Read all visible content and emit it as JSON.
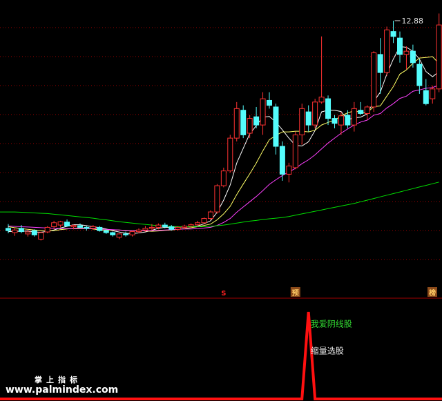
{
  "colors": {
    "background": "#000000",
    "grid": "#a00000",
    "up": "#ff3232",
    "down": "#54fcfc",
    "ma5": "#ffffff",
    "ma10": "#ffff66",
    "ma20": "#ff40ff",
    "ma60": "#00e000",
    "indicator": "#ff1010",
    "signal_box": "#8b4a1a"
  },
  "chart_data": [
    {
      "type": "candlestick",
      "title": "",
      "xlabel": "",
      "ylabel": "",
      "ylim": [
        5.2,
        13.3
      ],
      "grid": true,
      "high_label": "12.88",
      "high_value": 12.88,
      "series": [
        {
          "name": "",
          "role": "candles",
          "ohlc": [
            [
              6.55,
              6.68,
              6.4,
              6.48
            ],
            [
              6.42,
              6.58,
              6.32,
              6.5
            ],
            [
              6.55,
              6.65,
              6.4,
              6.45
            ],
            [
              6.38,
              6.52,
              6.3,
              6.44
            ],
            [
              6.48,
              6.52,
              6.3,
              6.35
            ],
            [
              6.22,
              6.45,
              6.18,
              6.42
            ],
            [
              6.44,
              6.62,
              6.4,
              6.58
            ],
            [
              6.6,
              6.78,
              6.52,
              6.72
            ],
            [
              6.65,
              6.78,
              6.58,
              6.75
            ],
            [
              6.74,
              6.82,
              6.6,
              6.62
            ],
            [
              6.6,
              6.66,
              6.52,
              6.64
            ],
            [
              6.63,
              6.7,
              6.55,
              6.58
            ],
            [
              6.58,
              6.62,
              6.48,
              6.55
            ],
            [
              6.55,
              6.65,
              6.5,
              6.6
            ],
            [
              6.58,
              6.62,
              6.45,
              6.48
            ],
            [
              6.48,
              6.52,
              6.38,
              6.42
            ],
            [
              6.42,
              6.45,
              6.3,
              6.35
            ],
            [
              6.28,
              6.4,
              6.22,
              6.38
            ],
            [
              6.38,
              6.45,
              6.3,
              6.35
            ],
            [
              6.35,
              6.48,
              6.3,
              6.45
            ],
            [
              6.45,
              6.55,
              6.4,
              6.5
            ],
            [
              6.5,
              6.62,
              6.45,
              6.55
            ],
            [
              6.55,
              6.68,
              6.48,
              6.58
            ],
            [
              6.58,
              6.7,
              6.52,
              6.65
            ],
            [
              6.65,
              6.72,
              6.55,
              6.6
            ],
            [
              6.6,
              6.65,
              6.48,
              6.52
            ],
            [
              6.52,
              6.62,
              6.48,
              6.58
            ],
            [
              6.58,
              6.66,
              6.52,
              6.62
            ],
            [
              6.62,
              6.7,
              6.56,
              6.66
            ],
            [
              6.66,
              6.78,
              6.6,
              6.72
            ],
            [
              6.72,
              6.88,
              6.68,
              6.85
            ],
            [
              6.85,
              7.1,
              6.8,
              7.05
            ],
            [
              7.05,
              7.9,
              7.0,
              7.85
            ],
            [
              7.85,
              8.4,
              7.8,
              8.3
            ],
            [
              8.3,
              9.4,
              8.25,
              9.3
            ],
            [
              9.3,
              10.4,
              9.2,
              10.2
            ],
            [
              10.15,
              10.3,
              9.3,
              9.4
            ],
            [
              9.45,
              10.0,
              9.3,
              9.9
            ],
            [
              9.95,
              10.25,
              9.6,
              9.7
            ],
            [
              9.7,
              10.7,
              9.4,
              10.5
            ],
            [
              10.45,
              10.7,
              10.2,
              10.3
            ],
            [
              10.25,
              10.35,
              8.8,
              9.05
            ],
            [
              9.05,
              9.2,
              8.0,
              8.2
            ],
            [
              8.2,
              8.55,
              7.95,
              8.45
            ],
            [
              8.4,
              9.5,
              8.35,
              9.4
            ],
            [
              9.4,
              10.35,
              9.1,
              10.2
            ],
            [
              10.1,
              10.3,
              9.5,
              9.7
            ],
            [
              9.7,
              10.5,
              9.6,
              10.4
            ],
            [
              10.4,
              12.4,
              10.35,
              10.55
            ],
            [
              10.5,
              10.6,
              9.7,
              9.9
            ],
            [
              9.9,
              10.0,
              9.6,
              9.75
            ],
            [
              9.7,
              10.1,
              9.4,
              9.98
            ],
            [
              10.0,
              10.15,
              9.6,
              9.7
            ],
            [
              9.7,
              10.4,
              9.5,
              10.2
            ],
            [
              10.15,
              10.4,
              10.0,
              10.05
            ],
            [
              10.05,
              10.3,
              9.85,
              10.25
            ],
            [
              10.25,
              11.95,
              10.1,
              11.9
            ],
            [
              11.85,
              12.35,
              10.65,
              11.3
            ],
            [
              11.3,
              12.7,
              11.2,
              12.6
            ],
            [
              12.55,
              12.88,
              12.2,
              12.4
            ],
            [
              12.35,
              12.55,
              11.6,
              11.85
            ],
            [
              11.85,
              12.1,
              11.4,
              11.95
            ],
            [
              11.95,
              12.15,
              11.45,
              11.6
            ],
            [
              11.55,
              11.7,
              10.65,
              10.9
            ],
            [
              10.75,
              11.1,
              10.3,
              10.35
            ],
            [
              10.5,
              10.9,
              10.35,
              10.8
            ],
            [
              10.8,
              13.1,
              10.7,
              12.75
            ]
          ]
        },
        {
          "name": "",
          "role": "ma5",
          "values": [
            6.45,
            6.46,
            6.46,
            6.47,
            6.44,
            6.43,
            6.46,
            6.5,
            6.56,
            6.61,
            6.66,
            6.66,
            6.63,
            6.6,
            6.57,
            6.53,
            6.48,
            6.44,
            6.4,
            6.39,
            6.41,
            6.44,
            6.49,
            6.55,
            6.58,
            6.58,
            6.59,
            6.59,
            6.6,
            6.62,
            6.69,
            6.78,
            7.04,
            7.41,
            7.87,
            8.54,
            8.99,
            9.43,
            9.68,
            9.94,
            9.96,
            9.79,
            9.55,
            9.3,
            9.08,
            9.06,
            9.19,
            9.53,
            10.1,
            10.15,
            10.15,
            10.11,
            9.86,
            9.92,
            9.94,
            10.04,
            10.42,
            10.7,
            11.25,
            11.71,
            12.09,
            12.07,
            11.95,
            11.71,
            11.33,
            11.17,
            11.33
          ]
        },
        {
          "name": "",
          "role": "ma10",
          "values": [
            6.6,
            6.57,
            6.54,
            6.52,
            6.5,
            6.49,
            6.48,
            6.48,
            6.51,
            6.53,
            6.55,
            6.56,
            6.55,
            6.53,
            6.5,
            6.5,
            6.5,
            6.5,
            6.48,
            6.48,
            6.48,
            6.47,
            6.46,
            6.47,
            6.49,
            6.5,
            6.52,
            6.54,
            6.57,
            6.6,
            6.64,
            6.68,
            6.81,
            6.99,
            7.22,
            7.58,
            7.9,
            8.21,
            8.54,
            8.91,
            9.25,
            9.38,
            9.49,
            9.49,
            9.51,
            9.51,
            9.49,
            9.54,
            9.7,
            9.78,
            9.84,
            9.98,
            10.07,
            10.13,
            10.09,
            10.08,
            10.26,
            10.28,
            10.58,
            10.87,
            11.25,
            11.38,
            11.58,
            11.74,
            11.76,
            11.78,
            11.57
          ]
        },
        {
          "name": "",
          "role": "ma20",
          "values": [
            6.62,
            6.61,
            6.6,
            6.59,
            6.58,
            6.57,
            6.56,
            6.55,
            6.54,
            6.54,
            6.54,
            6.54,
            6.54,
            6.54,
            6.53,
            6.52,
            6.51,
            6.5,
            6.49,
            6.48,
            6.48,
            6.48,
            6.48,
            6.49,
            6.5,
            6.51,
            6.52,
            6.53,
            6.53,
            6.54,
            6.56,
            6.58,
            6.64,
            6.73,
            6.85,
            7.04,
            7.2,
            7.36,
            7.52,
            7.7,
            7.89,
            8.03,
            8.16,
            8.27,
            8.38,
            8.52,
            8.64,
            8.79,
            8.97,
            9.15,
            9.3,
            9.45,
            9.58,
            9.7,
            9.79,
            9.85,
            10.0,
            10.05,
            10.22,
            10.35,
            10.51,
            10.58,
            10.73,
            10.77,
            10.82,
            10.84,
            10.92
          ]
        },
        {
          "name": "",
          "role": "ma60",
          "values": [
            7.05,
            7.05,
            7.04,
            7.03,
            7.02,
            7.01,
            7.0,
            6.98,
            6.96,
            6.94,
            6.92,
            6.9,
            6.88,
            6.86,
            6.83,
            6.81,
            6.78,
            6.75,
            6.73,
            6.71,
            6.69,
            6.67,
            6.65,
            6.63,
            6.62,
            6.61,
            6.6,
            6.6,
            6.6,
            6.6,
            6.6,
            6.61,
            6.63,
            6.65,
            6.68,
            6.71,
            6.74,
            6.77,
            6.79,
            6.82,
            6.84,
            6.86,
            6.88,
            6.91,
            6.95,
            6.99,
            7.03,
            7.07,
            7.11,
            7.15,
            7.19,
            7.23,
            7.27,
            7.31,
            7.36,
            7.41,
            7.46,
            7.51,
            7.56,
            7.61,
            7.66,
            7.71,
            7.76,
            7.81,
            7.86,
            7.91,
            7.96
          ]
        }
      ],
      "signals": [
        {
          "index": 33,
          "text": "S",
          "style": "text",
          "color": "#ff2020"
        },
        {
          "index": 44,
          "text": "预",
          "style": "box",
          "color": "#ffcc66"
        },
        {
          "index": 66,
          "text": "榜",
          "style": "box",
          "color": "#ffcc66"
        }
      ]
    },
    {
      "type": "line",
      "title": "",
      "xlabel": "",
      "ylabel": "",
      "ylim": [
        0,
        100
      ],
      "series": [
        {
          "name": "",
          "values": [
            0,
            0,
            0,
            0,
            0,
            0,
            0,
            0,
            0,
            0,
            0,
            0,
            0,
            0,
            0,
            0,
            0,
            0,
            0,
            0,
            0,
            0,
            0,
            0,
            0,
            0,
            0,
            0,
            0,
            0,
            0,
            0,
            0,
            0,
            0,
            0,
            0,
            0,
            0,
            0,
            0,
            0,
            0,
            0,
            0,
            0,
            100,
            0,
            0,
            0,
            0,
            0,
            0,
            0,
            0,
            0,
            0,
            0,
            0,
            0,
            0,
            0,
            0,
            0,
            0,
            0,
            0,
            0
          ]
        }
      ],
      "annotations": [
        {
          "text": "我爱阴线股",
          "index": 46,
          "level": 86,
          "color": "green"
        },
        {
          "text": "缩量选股",
          "index": 46,
          "level": 55,
          "color": "white"
        }
      ]
    }
  ],
  "watermark": {
    "line1": "掌上指标",
    "line2": "www.palmindex.com"
  }
}
